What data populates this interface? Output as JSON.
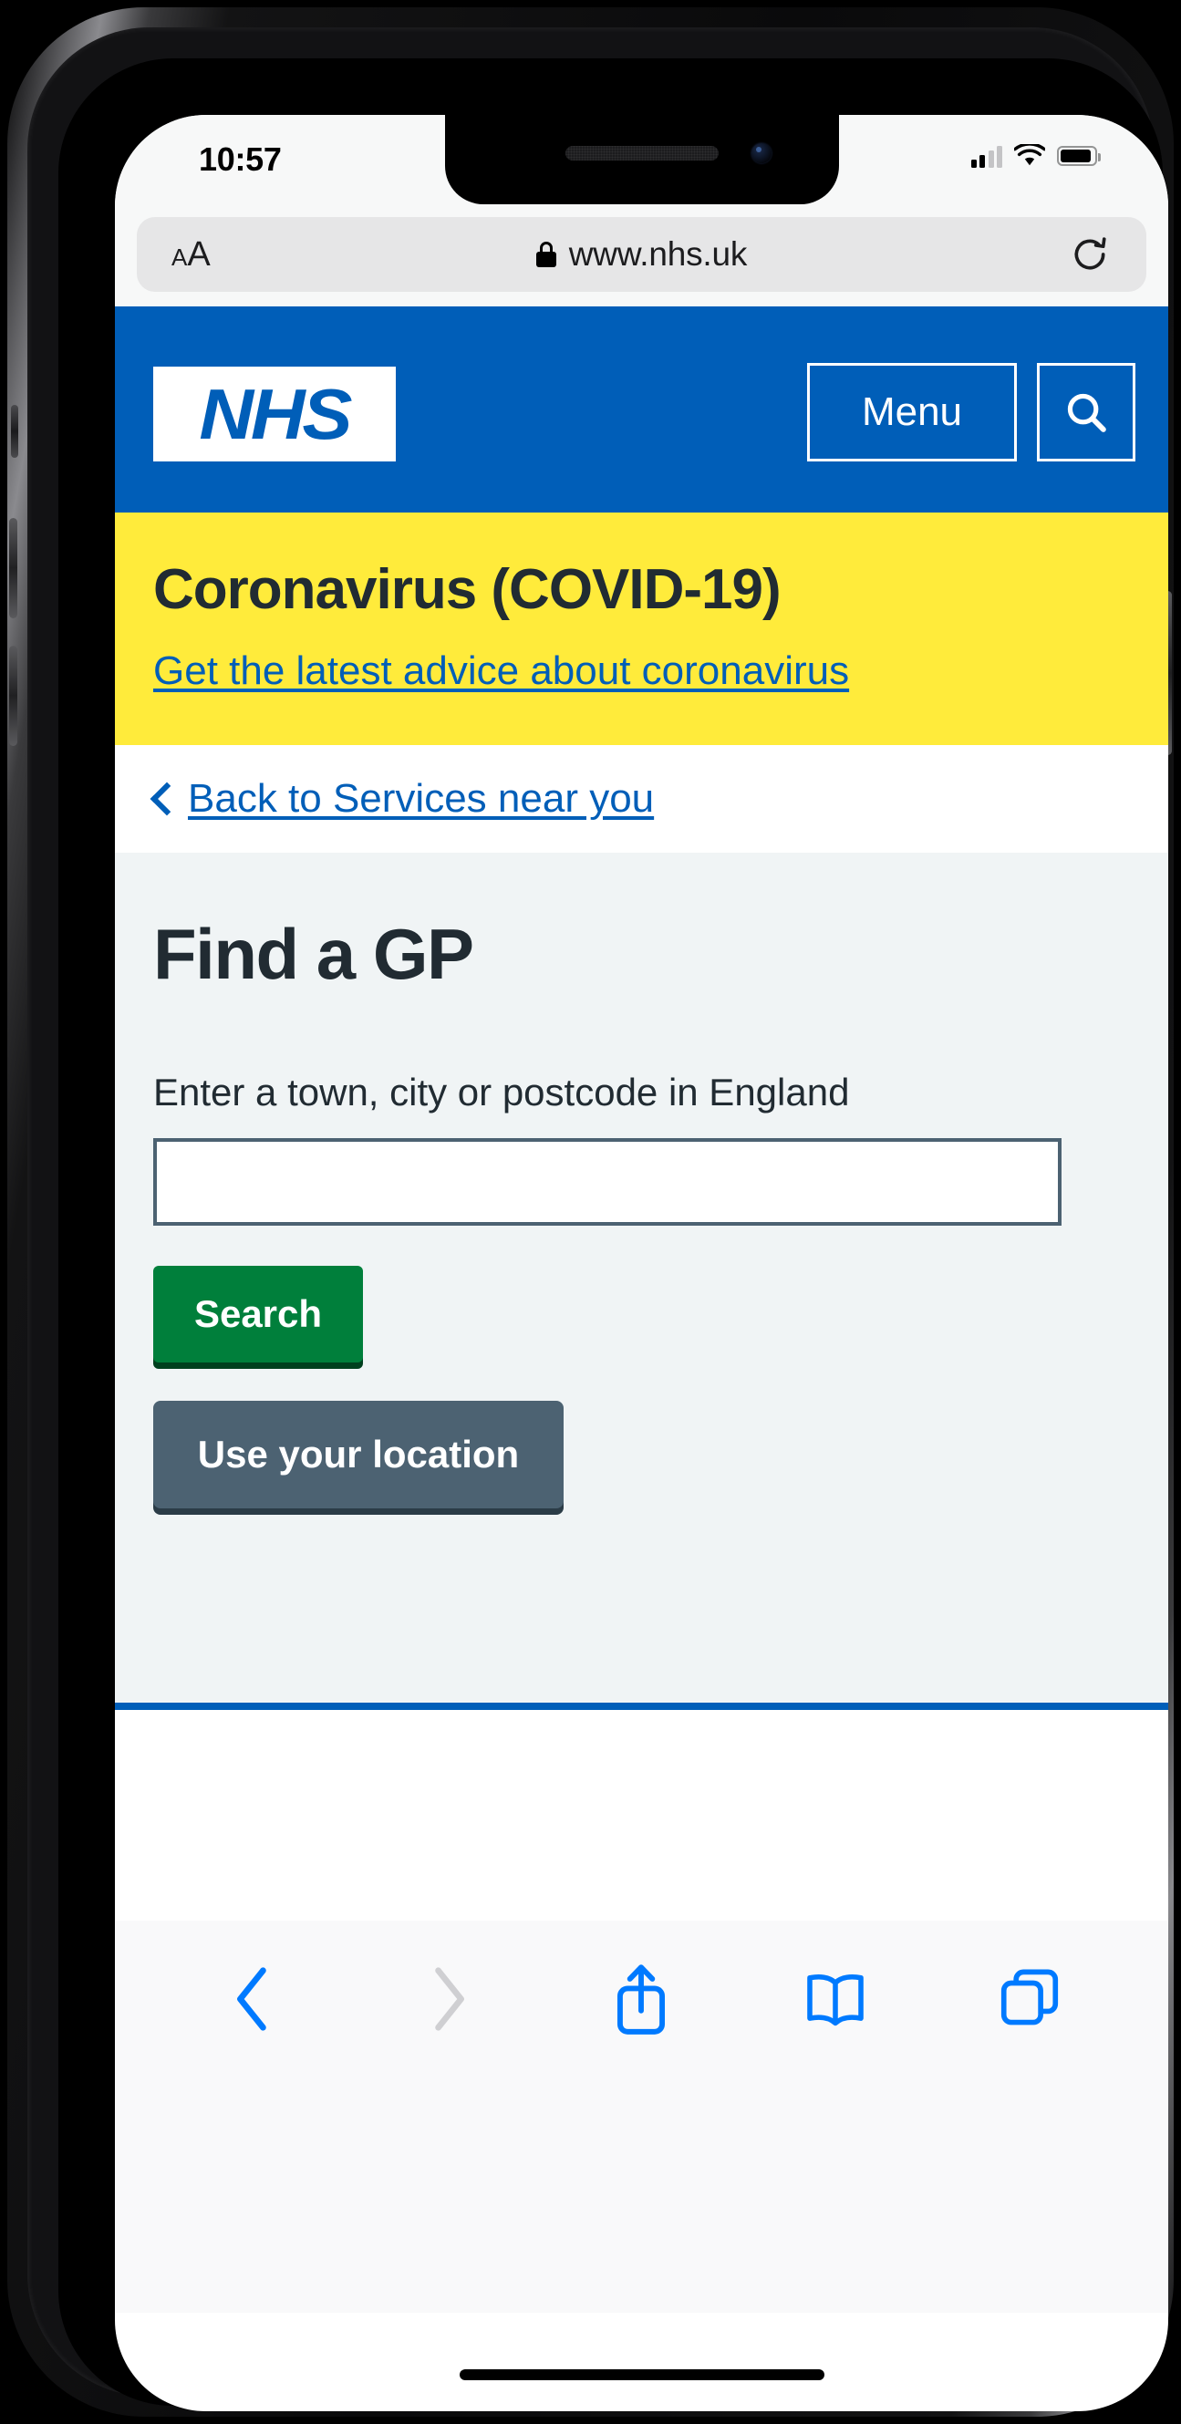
{
  "status_bar": {
    "time": "10:57",
    "cellular_icon": "cellular-signal-icon",
    "wifi_icon": "wifi-icon",
    "battery_icon": "battery-icon"
  },
  "browser": {
    "font_size_label_small": "A",
    "font_size_label_large": "A",
    "lock_icon": "lock-icon",
    "url": "www.nhs.uk",
    "reload_icon": "reload-icon",
    "toolbar": {
      "back_icon": "chevron-left-icon",
      "forward_icon": "chevron-right-icon",
      "share_icon": "share-icon",
      "bookmarks_icon": "book-icon",
      "tabs_icon": "tabs-icon"
    }
  },
  "site_header": {
    "logo_text": "NHS",
    "menu_label": "Menu",
    "search_icon": "search-icon"
  },
  "covid_banner": {
    "title": "Coronavirus (COVID-19)",
    "link_text": "Get the latest advice about coronavirus"
  },
  "breadcrumb": {
    "chevron_icon": "chevron-left-icon",
    "label": "Back to Services near you"
  },
  "main": {
    "title": "Find a GP",
    "field_label": "Enter a town, city or postcode in England",
    "input_value": "",
    "input_placeholder": "",
    "search_button": "Search",
    "location_button": "Use your location"
  },
  "colors": {
    "nhs_blue": "#005eb8",
    "nhs_yellow": "#ffeb3b",
    "nhs_green": "#007f3b",
    "nhs_grey_blue": "#4c6272",
    "panel_grey": "#f0f4f5",
    "text_dark": "#212b32",
    "safari_blue": "#007aff"
  }
}
